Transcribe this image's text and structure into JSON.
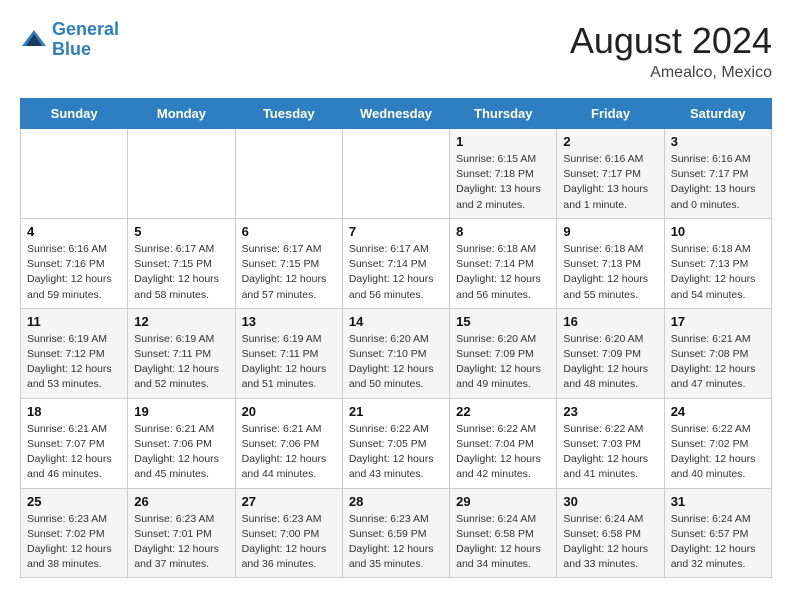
{
  "header": {
    "logo_line1": "General",
    "logo_line2": "Blue",
    "month": "August 2024",
    "location": "Amealco, Mexico"
  },
  "weekdays": [
    "Sunday",
    "Monday",
    "Tuesday",
    "Wednesday",
    "Thursday",
    "Friday",
    "Saturday"
  ],
  "weeks": [
    [
      {
        "day": "",
        "info": ""
      },
      {
        "day": "",
        "info": ""
      },
      {
        "day": "",
        "info": ""
      },
      {
        "day": "",
        "info": ""
      },
      {
        "day": "1",
        "info": "Sunrise: 6:15 AM\nSunset: 7:18 PM\nDaylight: 13 hours\nand 2 minutes."
      },
      {
        "day": "2",
        "info": "Sunrise: 6:16 AM\nSunset: 7:17 PM\nDaylight: 13 hours\nand 1 minute."
      },
      {
        "day": "3",
        "info": "Sunrise: 6:16 AM\nSunset: 7:17 PM\nDaylight: 13 hours\nand 0 minutes."
      }
    ],
    [
      {
        "day": "4",
        "info": "Sunrise: 6:16 AM\nSunset: 7:16 PM\nDaylight: 12 hours\nand 59 minutes."
      },
      {
        "day": "5",
        "info": "Sunrise: 6:17 AM\nSunset: 7:15 PM\nDaylight: 12 hours\nand 58 minutes."
      },
      {
        "day": "6",
        "info": "Sunrise: 6:17 AM\nSunset: 7:15 PM\nDaylight: 12 hours\nand 57 minutes."
      },
      {
        "day": "7",
        "info": "Sunrise: 6:17 AM\nSunset: 7:14 PM\nDaylight: 12 hours\nand 56 minutes."
      },
      {
        "day": "8",
        "info": "Sunrise: 6:18 AM\nSunset: 7:14 PM\nDaylight: 12 hours\nand 56 minutes."
      },
      {
        "day": "9",
        "info": "Sunrise: 6:18 AM\nSunset: 7:13 PM\nDaylight: 12 hours\nand 55 minutes."
      },
      {
        "day": "10",
        "info": "Sunrise: 6:18 AM\nSunset: 7:13 PM\nDaylight: 12 hours\nand 54 minutes."
      }
    ],
    [
      {
        "day": "11",
        "info": "Sunrise: 6:19 AM\nSunset: 7:12 PM\nDaylight: 12 hours\nand 53 minutes."
      },
      {
        "day": "12",
        "info": "Sunrise: 6:19 AM\nSunset: 7:11 PM\nDaylight: 12 hours\nand 52 minutes."
      },
      {
        "day": "13",
        "info": "Sunrise: 6:19 AM\nSunset: 7:11 PM\nDaylight: 12 hours\nand 51 minutes."
      },
      {
        "day": "14",
        "info": "Sunrise: 6:20 AM\nSunset: 7:10 PM\nDaylight: 12 hours\nand 50 minutes."
      },
      {
        "day": "15",
        "info": "Sunrise: 6:20 AM\nSunset: 7:09 PM\nDaylight: 12 hours\nand 49 minutes."
      },
      {
        "day": "16",
        "info": "Sunrise: 6:20 AM\nSunset: 7:09 PM\nDaylight: 12 hours\nand 48 minutes."
      },
      {
        "day": "17",
        "info": "Sunrise: 6:21 AM\nSunset: 7:08 PM\nDaylight: 12 hours\nand 47 minutes."
      }
    ],
    [
      {
        "day": "18",
        "info": "Sunrise: 6:21 AM\nSunset: 7:07 PM\nDaylight: 12 hours\nand 46 minutes."
      },
      {
        "day": "19",
        "info": "Sunrise: 6:21 AM\nSunset: 7:06 PM\nDaylight: 12 hours\nand 45 minutes."
      },
      {
        "day": "20",
        "info": "Sunrise: 6:21 AM\nSunset: 7:06 PM\nDaylight: 12 hours\nand 44 minutes."
      },
      {
        "day": "21",
        "info": "Sunrise: 6:22 AM\nSunset: 7:05 PM\nDaylight: 12 hours\nand 43 minutes."
      },
      {
        "day": "22",
        "info": "Sunrise: 6:22 AM\nSunset: 7:04 PM\nDaylight: 12 hours\nand 42 minutes."
      },
      {
        "day": "23",
        "info": "Sunrise: 6:22 AM\nSunset: 7:03 PM\nDaylight: 12 hours\nand 41 minutes."
      },
      {
        "day": "24",
        "info": "Sunrise: 6:22 AM\nSunset: 7:02 PM\nDaylight: 12 hours\nand 40 minutes."
      }
    ],
    [
      {
        "day": "25",
        "info": "Sunrise: 6:23 AM\nSunset: 7:02 PM\nDaylight: 12 hours\nand 38 minutes."
      },
      {
        "day": "26",
        "info": "Sunrise: 6:23 AM\nSunset: 7:01 PM\nDaylight: 12 hours\nand 37 minutes."
      },
      {
        "day": "27",
        "info": "Sunrise: 6:23 AM\nSunset: 7:00 PM\nDaylight: 12 hours\nand 36 minutes."
      },
      {
        "day": "28",
        "info": "Sunrise: 6:23 AM\nSunset: 6:59 PM\nDaylight: 12 hours\nand 35 minutes."
      },
      {
        "day": "29",
        "info": "Sunrise: 6:24 AM\nSunset: 6:58 PM\nDaylight: 12 hours\nand 34 minutes."
      },
      {
        "day": "30",
        "info": "Sunrise: 6:24 AM\nSunset: 6:58 PM\nDaylight: 12 hours\nand 33 minutes."
      },
      {
        "day": "31",
        "info": "Sunrise: 6:24 AM\nSunset: 6:57 PM\nDaylight: 12 hours\nand 32 minutes."
      }
    ]
  ]
}
